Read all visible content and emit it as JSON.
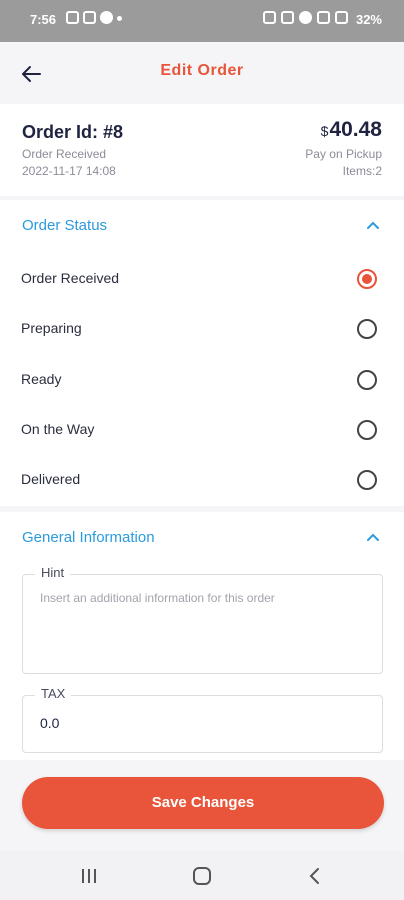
{
  "status_bar": {
    "time": "7:56",
    "battery": "32%",
    "left_icons": [
      "photo-icon",
      "messenger-icon",
      "phone-icon",
      "dot-icon"
    ],
    "right_icons": [
      "alarm-icon",
      "mute-icon",
      "location-icon",
      "wifi-icon",
      "signal-icon"
    ]
  },
  "header": {
    "title": "Edit Order",
    "back_icon": "arrow-left-icon"
  },
  "order": {
    "id_label": "Order Id: #8",
    "status": "Order Received",
    "datetime": "2022-11-17 14:08",
    "currency": "$",
    "amount": "40.48",
    "payment": "Pay on Pickup",
    "items": "Items:2"
  },
  "order_status": {
    "title": "Order Status",
    "expanded": true,
    "options": [
      {
        "label": "Order Received",
        "selected": true
      },
      {
        "label": "Preparing",
        "selected": false
      },
      {
        "label": "Ready",
        "selected": false
      },
      {
        "label": "On the Way",
        "selected": false
      },
      {
        "label": "Delivered",
        "selected": false
      }
    ]
  },
  "general_info": {
    "title": "General Information",
    "expanded": true,
    "hint": {
      "label": "Hint",
      "placeholder": "Insert an additional information for this order",
      "value": ""
    },
    "tax": {
      "label": "TAX",
      "value": "0.0"
    }
  },
  "actions": {
    "save_label": "Save Changes"
  },
  "colors": {
    "accent": "#e8553a",
    "section_title": "#2b9bde",
    "text_dark": "#1f2340"
  }
}
